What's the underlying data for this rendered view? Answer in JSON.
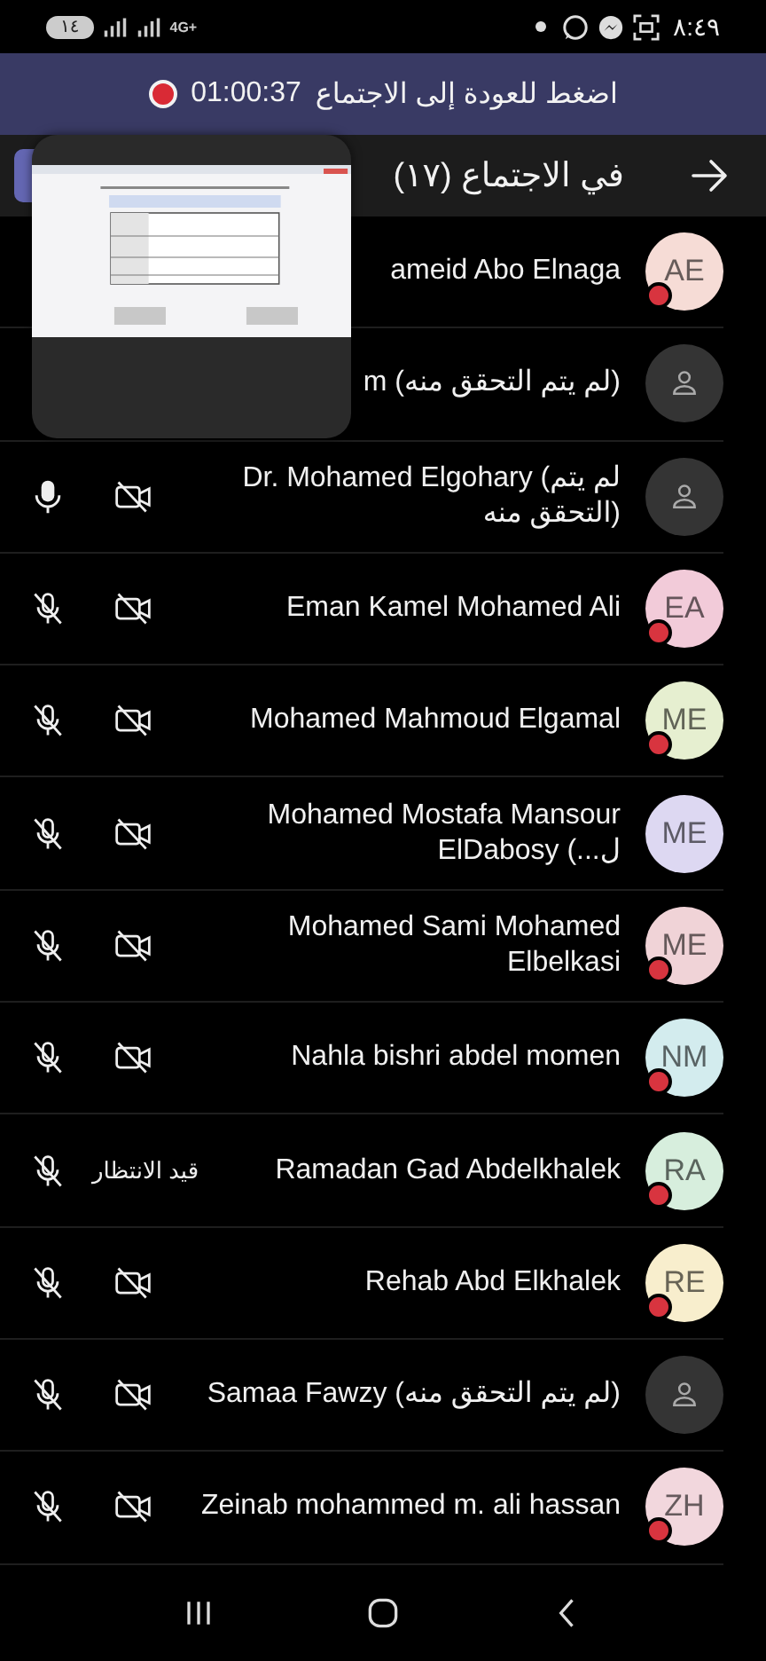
{
  "status_bar": {
    "battery": "١٤",
    "network": "4G+",
    "time": "٨:٤٩"
  },
  "banner": {
    "text": "اضغط للعودة إلى الاجتماع",
    "timer": "01:00:37",
    "recording": true
  },
  "header": {
    "title": "في الاجتماع (١٧)"
  },
  "participants": [
    {
      "name": "ameid Abo Elnaga",
      "avatar": {
        "kind": "initials",
        "initials": "AE",
        "color": "#f6dcd6"
      },
      "presence_dot": true
    },
    {
      "name": "m (لم يتم التحقق منه)",
      "avatar": {
        "kind": "generic"
      },
      "presence_dot": false
    },
    {
      "name": "Dr. Mohamed Elgohary (لم يتم التحقق منه)",
      "avatar": {
        "kind": "generic"
      },
      "presence_dot": false,
      "mic_muted": false,
      "camera_off": true
    },
    {
      "name": "Eman Kamel Mohamed Ali",
      "avatar": {
        "kind": "initials",
        "initials": "EA",
        "color": "#f2cbd9"
      },
      "presence_dot": true,
      "mic_muted": true,
      "camera_off": true
    },
    {
      "name": "Mohamed Mahmoud Elgamal",
      "avatar": {
        "kind": "initials",
        "initials": "ME",
        "color": "#e6efd0"
      },
      "presence_dot": true,
      "mic_muted": true,
      "camera_off": true
    },
    {
      "name": "Mohamed Mostafa Mansour ElDabosy (...ل",
      "avatar": {
        "kind": "initials",
        "initials": "ME",
        "color": "#ddd8f2"
      },
      "presence_dot": false,
      "mic_muted": true,
      "camera_off": true
    },
    {
      "name": "Mohamed Sami Mohamed Elbelkasi",
      "avatar": {
        "kind": "initials",
        "initials": "ME",
        "color": "#f0d3d7"
      },
      "presence_dot": true,
      "mic_muted": true,
      "camera_off": true
    },
    {
      "name": "Nahla bishri abdel momen",
      "avatar": {
        "kind": "initials",
        "initials": "NM",
        "color": "#d3ecee"
      },
      "presence_dot": true,
      "mic_muted": true,
      "camera_off": true
    },
    {
      "name": "Ramadan Gad Abdelkhalek",
      "avatar": {
        "kind": "initials",
        "initials": "RA",
        "color": "#d7eedd"
      },
      "presence_dot": true,
      "mic_muted": true,
      "status": "قيد الانتظار"
    },
    {
      "name": "Rehab Abd Elkhalek",
      "avatar": {
        "kind": "initials",
        "initials": "RE",
        "color": "#f8eecd"
      },
      "presence_dot": true,
      "mic_muted": true,
      "camera_off": true
    },
    {
      "name": "Samaa Fawzy (لم يتم التحقق منه)",
      "avatar": {
        "kind": "generic"
      },
      "presence_dot": false,
      "mic_muted": true,
      "camera_off": true
    },
    {
      "name": "Zeinab mohammed m. ali hassan",
      "avatar": {
        "kind": "initials",
        "initials": "ZH",
        "color": "#f2d7dd"
      },
      "presence_dot": true,
      "mic_muted": true,
      "camera_off": true
    }
  ]
}
